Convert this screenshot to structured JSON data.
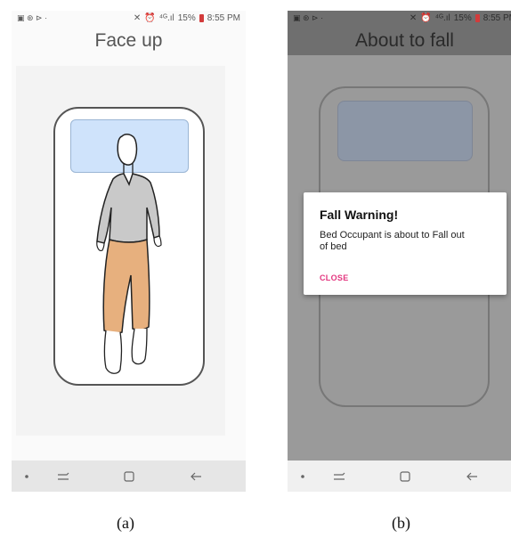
{
  "screen_a": {
    "status": {
      "left_icons": "▣ ⊛ ⊳ ·",
      "battery": "15%",
      "time": "8:55 PM"
    },
    "title": "Face up",
    "caption": "(a)"
  },
  "screen_b": {
    "status": {
      "left_icons": "▣ ⊛ ⊳ ·",
      "battery": "15%",
      "time": "8:55 PM"
    },
    "title": "About to fall",
    "dialog": {
      "title": "Fall Warning!",
      "message": "Bed Occupant is about to Fall out of bed",
      "close_label": "CLOSE"
    },
    "caption": "(b)"
  },
  "colors": {
    "pillow_a": "#cfe3fb",
    "shirt": "#c9c9c9",
    "pants": "#e7b07e",
    "dim_overlay": "#9a9a9a",
    "close_accent": "#e3367f"
  }
}
